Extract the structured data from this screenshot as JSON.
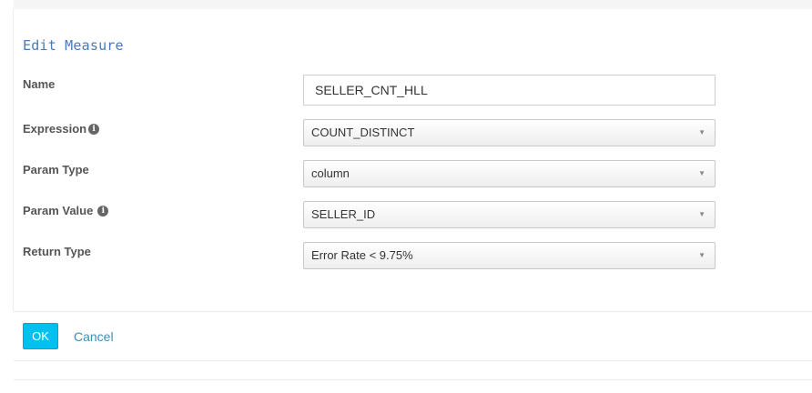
{
  "panel": {
    "title": "Edit Measure"
  },
  "form": {
    "name": {
      "label": "Name",
      "value": "SELLER_CNT_HLL"
    },
    "expression": {
      "label": "Expression",
      "info_icon": "info-icon",
      "selected": "COUNT_DISTINCT"
    },
    "param_type": {
      "label": "Param Type",
      "selected": "column"
    },
    "param_value": {
      "label": "Param Value",
      "info_icon": "info-icon",
      "selected": "SELLER_ID"
    },
    "return_type": {
      "label": "Return Type",
      "selected": "Error Rate < 9.75%"
    }
  },
  "actions": {
    "ok_label": "OK",
    "cancel_label": "Cancel"
  },
  "colors": {
    "accent": "#00c0ef",
    "link": "#3c8dbc",
    "title": "#4a7ab5"
  }
}
